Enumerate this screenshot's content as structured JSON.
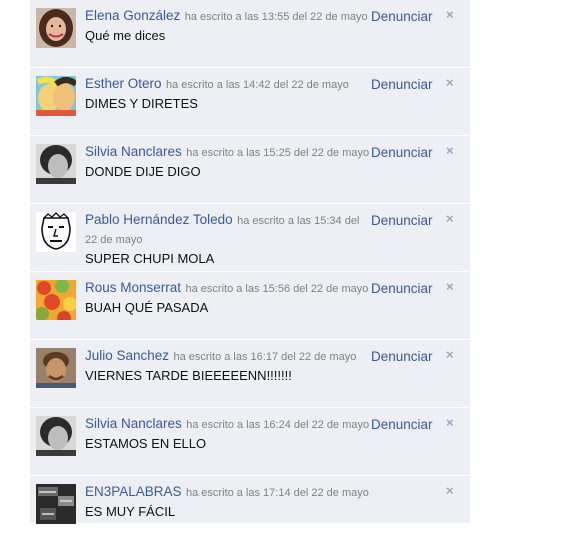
{
  "comments": [
    {
      "author": "Elena González",
      "meta": "ha escrito a las 13:55 del 22 de mayo",
      "text": "Qué me dices",
      "report": "Denunciar",
      "close": "×",
      "avatar": "woman-smiling-photo"
    },
    {
      "author": "Esther Otero",
      "meta": "ha escrito a las 14:42 del 22 de mayo",
      "text": "DIMES Y DIRETES",
      "report": "Denunciar",
      "close": "×",
      "avatar": "comic-kiss-illustration"
    },
    {
      "author": "Silvia Nanclares",
      "meta": "ha escrito a las 15:25 del 22 de mayo",
      "text": "DONDE DIJE DIGO",
      "report": "Denunciar",
      "close": "×",
      "avatar": "bw-woman-photo"
    },
    {
      "author": "Pablo Hernández Toledo",
      "meta": "ha escrito a las 15:34 del 22 de mayo",
      "text": "SUPER CHUPI MOLA",
      "report": "Denunciar",
      "close": "×",
      "avatar": "face-sketch-drawing"
    },
    {
      "author": "Rous Monserrat",
      "meta": "ha escrito a las 15:56 del 22 de mayo",
      "text": "BUAH QUÉ PASADA",
      "report": "Denunciar",
      "close": "×",
      "avatar": "colorful-dots-pattern"
    },
    {
      "author": "Julio Sanchez",
      "meta": "ha escrito a las 16:17 del 22 de mayo",
      "text": "VIERNES TARDE BIEEEEENN!!!!!!!",
      "report": "Denunciar",
      "close": "×",
      "avatar": "man-photo"
    },
    {
      "author": "Silvia Nanclares",
      "meta": "ha escrito a las 16:24 del 22 de mayo",
      "text": "ESTAMOS EN ELLO",
      "report": "Denunciar",
      "close": "×",
      "avatar": "bw-woman-photo"
    },
    {
      "author": "EN3PALABRAS",
      "meta": "ha escrito a las 17:14 del 22 de mayo",
      "text": "ES MUY FÁCIL",
      "close": "×",
      "avatar": "text-collage-logo"
    }
  ]
}
